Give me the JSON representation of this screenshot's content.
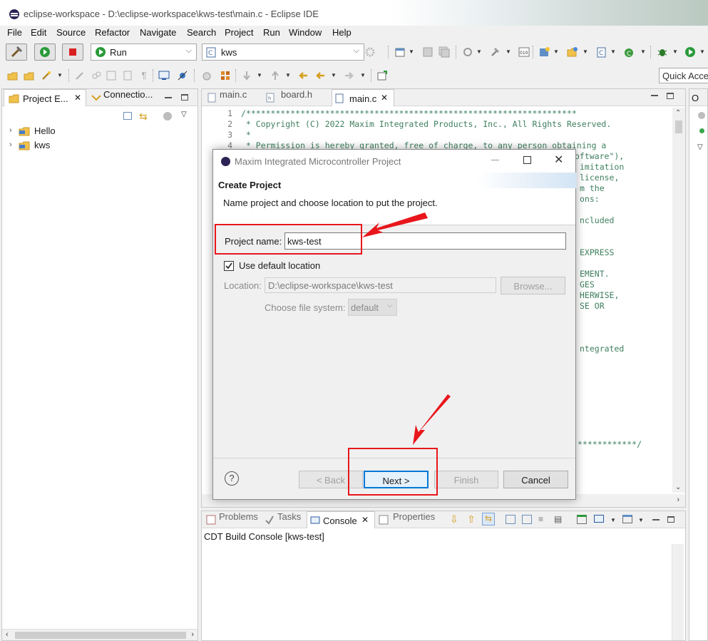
{
  "window": {
    "title": "eclipse-workspace - D:\\eclipse-workspace\\kws-test\\main.c - Eclipse IDE"
  },
  "menu": [
    "File",
    "Edit",
    "Source",
    "Refactor",
    "Navigate",
    "Search",
    "Project",
    "Run",
    "Window",
    "Help"
  ],
  "toolbar": {
    "run_config": "Run",
    "target": "kws",
    "quick_access": "Quick Acce"
  },
  "project_explorer": {
    "tabs": [
      "Project E...",
      "Connectio..."
    ],
    "projects": [
      "Hello",
      "kws"
    ]
  },
  "editor": {
    "tabs": [
      "main.c",
      "board.h",
      "main.c"
    ],
    "lines": [
      {
        "n": "1",
        "text": "/*******************************************************************"
      },
      {
        "n": "2",
        "text": " * Copyright (C) 2022 Maxim Integrated Products, Inc., All Rights Reserved."
      },
      {
        "n": "3",
        "text": " *"
      },
      {
        "n": "4",
        "text": " * Permission is hereby granted, free of charge, to any person obtaining a"
      }
    ],
    "right_fragments": [
      "oftware\"),",
      "imitation",
      "license,",
      "m the",
      "ons:",
      "ncluded",
      "EXPRESS",
      "EMENT.",
      "GES",
      "HERWISE,",
      "SE OR",
      "ntegrated",
      "************/"
    ]
  },
  "console": {
    "tabs": [
      "Problems",
      "Tasks",
      "Console",
      "Properties"
    ],
    "header": "CDT Build Console [kws-test]"
  },
  "outline_tab": "O",
  "dialog": {
    "title": "Maxim Integrated Microcontroller Project",
    "heading": "Create Project",
    "description": "Name project and choose location to put the project.",
    "project_name_label": "Project name:",
    "project_name_value": "kws-test",
    "use_default_label": "Use default location",
    "use_default_checked": true,
    "location_label": "Location:",
    "location_value": "D:\\eclipse-workspace\\kws-test",
    "browse_label": "Browse...",
    "file_system_label": "Choose file system:",
    "file_system_value": "default",
    "back_label": "< Back",
    "next_label": "Next >",
    "finish_label": "Finish",
    "cancel_label": "Cancel",
    "help_icon": "?"
  },
  "colors": {
    "annotation_red": "#e8161b",
    "comment_green": "#3f7f5f",
    "accent_blue": "#0078d7"
  }
}
